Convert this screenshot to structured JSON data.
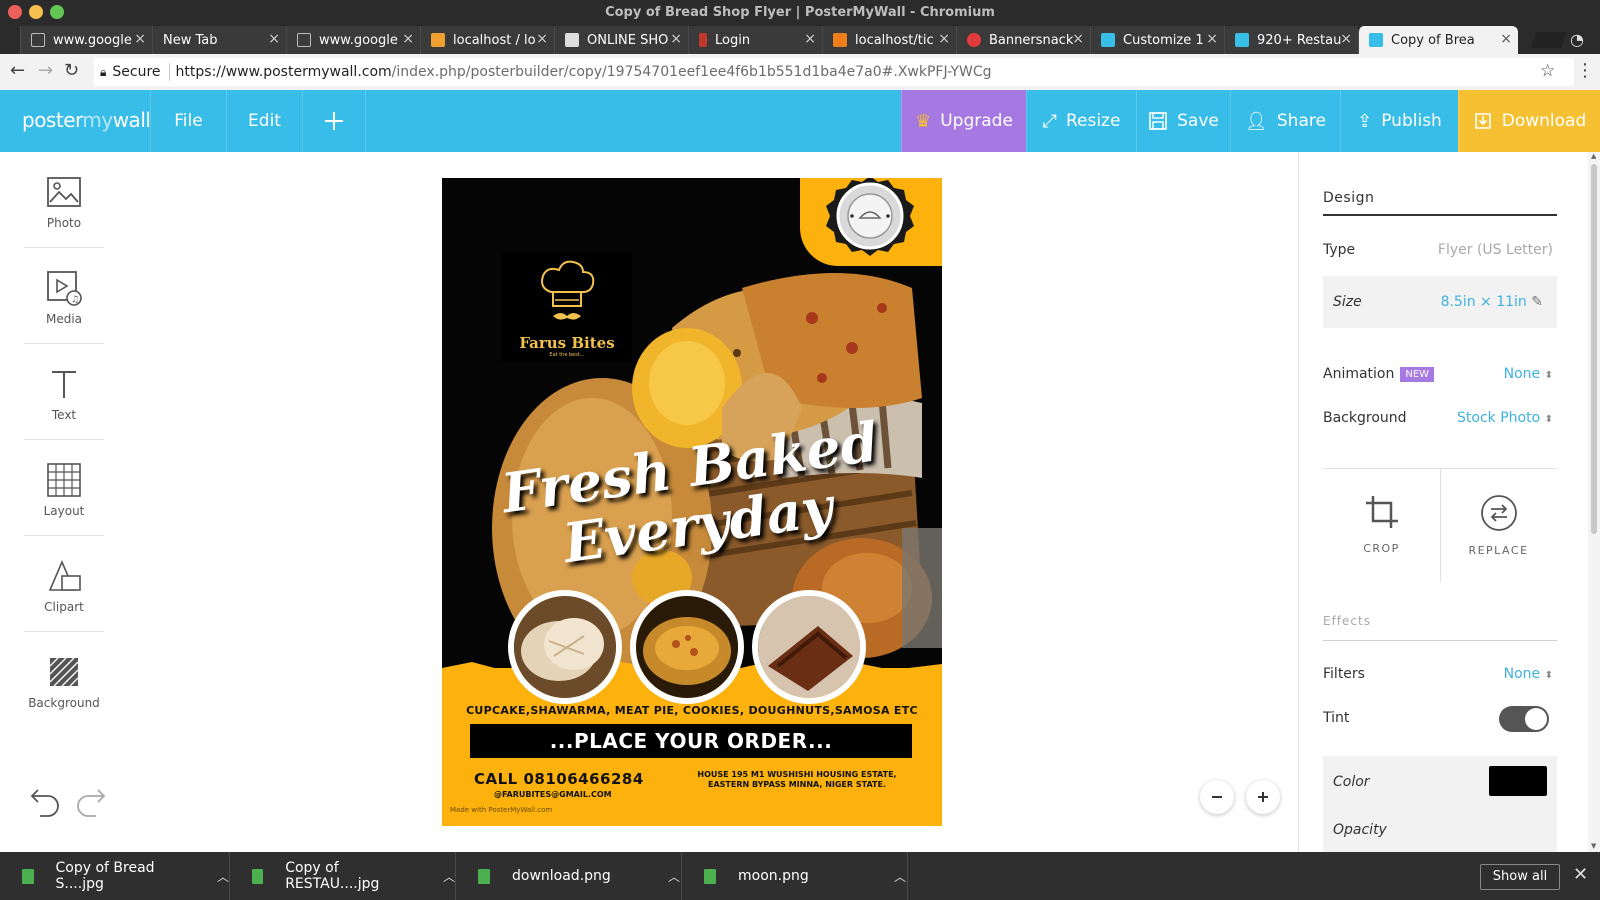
{
  "window": {
    "title": "Copy of Bread Shop Flyer | PosterMyWall - Chromium",
    "traffic_colors": [
      "#ec5f5a",
      "#f5be4f",
      "#62c554"
    ]
  },
  "tabs": [
    {
      "label": "www.google",
      "favicon_color": "#bbbbbb"
    },
    {
      "label": "New Tab",
      "favicon_color": ""
    },
    {
      "label": "www.google",
      "favicon_color": "#bbbbbb"
    },
    {
      "label": "localhost / lo",
      "favicon_color": "#f0a030"
    },
    {
      "label": "ONLINE SHO",
      "favicon_color": "#dddddd"
    },
    {
      "label": "Login",
      "favicon_color": "#c0392b"
    },
    {
      "label": "localhost/tic",
      "favicon_color": "#f07f20"
    },
    {
      "label": "Bannersnack",
      "favicon_color": "#e23b3b"
    },
    {
      "label": "Customize 1",
      "favicon_color": "#37bde8"
    },
    {
      "label": "920+ Restau",
      "favicon_color": "#37bde8"
    },
    {
      "label": "Copy of Brea",
      "favicon_color": "#37bde8"
    }
  ],
  "address": {
    "secure_label": "Secure",
    "url_host": "https://www.postermywall.com",
    "url_path": "/index.php/posterbuilder/copy/19754701eef1ee4f6b1b551d1ba4e7a0#.XwkPFJ-YWCg"
  },
  "app": {
    "logo_left": "poster",
    "logo_mid": "my",
    "logo_right": "wall",
    "menu": {
      "file": "File",
      "edit": "Edit"
    },
    "actions": {
      "upgrade": "Upgrade",
      "resize": "Resize",
      "save": "Save",
      "share": "Share",
      "publish": "Publish",
      "download": "Download"
    },
    "colors": {
      "header": "#37bde8",
      "upgrade": "#a679e2",
      "download": "#f5c132"
    }
  },
  "tools": [
    {
      "label": "Photo",
      "icon": "photo-icon"
    },
    {
      "label": "Media",
      "icon": "media-icon"
    },
    {
      "label": "Text",
      "icon": "text-icon"
    },
    {
      "label": "Layout",
      "icon": "layout-icon"
    },
    {
      "label": "Clipart",
      "icon": "clipart-icon"
    },
    {
      "label": "Background",
      "icon": "background-icon"
    }
  ],
  "flyer": {
    "brand_name": "Farus Bites",
    "brand_tagline": "Eat the best...",
    "headline_line1": "Fresh Baked",
    "headline_line2": "Everyday",
    "items": "CUPCAKE,SHAWARMA, MEAT PIE, COOKIES, DOUGHNUTS,SAMOSA ETC",
    "order": "...PLACE YOUR ORDER...",
    "call": "CALL 08106466284",
    "email": "@FARUBITES@GMAIL.COM",
    "address_line1": "HOUSE 195 M1 WUSHISHI HOUSING ESTATE,",
    "address_line2": "EASTERN BYPASS MINNA, NIGER STATE.",
    "made_with": "Made with PosterMyWall.com",
    "accent_color": "#fcb10c"
  },
  "design_panel": {
    "tab": "Design",
    "type_label": "Type",
    "type_value": "Flyer (US Letter)",
    "size_label": "Size",
    "size_value": "8.5in × 11in",
    "animation_label": "Animation",
    "animation_badge": "NEW",
    "animation_value": "None",
    "background_label": "Background",
    "background_value": "Stock Photo",
    "crop_label": "CROP",
    "replace_label": "REPLACE",
    "effects_label": "Effects",
    "filters_label": "Filters",
    "filters_value": "None",
    "tint_label": "Tint",
    "tint_on": true,
    "color_label": "Color",
    "color_value": "#000000",
    "opacity_label": "Opacity"
  },
  "downloads": [
    {
      "name": "Copy of Bread S....jpg"
    },
    {
      "name": "Copy of RESTAU....jpg"
    },
    {
      "name": "download.png"
    },
    {
      "name": "moon.png"
    }
  ],
  "shelf": {
    "show_all": "Show all"
  }
}
